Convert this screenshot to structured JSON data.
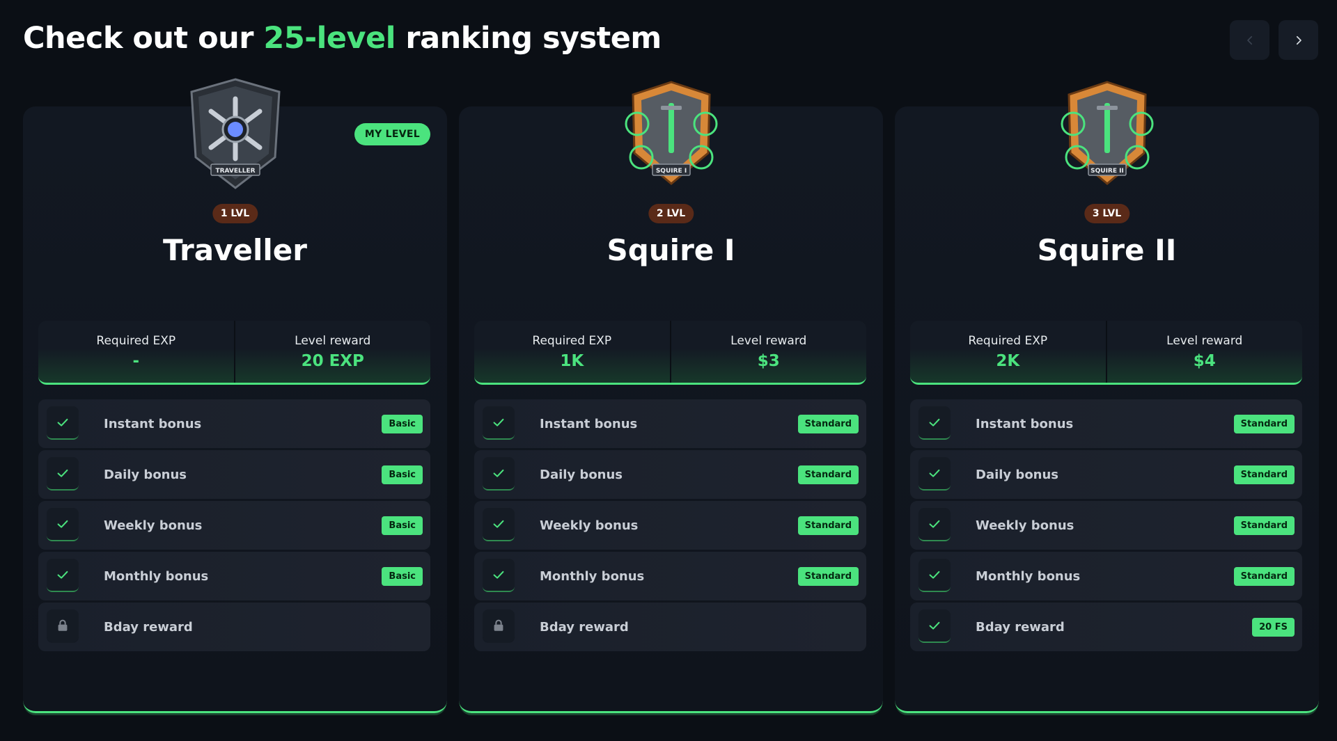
{
  "header": {
    "title_prefix": "Check out our ",
    "title_accent": "25-level",
    "title_suffix": " ranking system"
  },
  "nav": {
    "prev_icon": "chevron-left-icon",
    "next_icon": "chevron-right-icon"
  },
  "colors": {
    "accent": "#4be37e",
    "background": "#0b0f15",
    "card": "#121822",
    "level_pill": "#5a2a18"
  },
  "cards": [
    {
      "badge_text": "TRAVELLER",
      "badge_icon": "traveller-badge-icon",
      "my_level": "MY LEVEL",
      "level": "1 LVL",
      "name": "Traveller",
      "required_exp_label": "Required EXP",
      "required_exp": "-",
      "reward_label": "Level reward",
      "reward": "20 EXP",
      "features": [
        {
          "label": "Instant bonus",
          "tag": "Basic",
          "icon": "check-icon"
        },
        {
          "label": "Daily bonus",
          "tag": "Basic",
          "icon": "check-icon"
        },
        {
          "label": "Weekly bonus",
          "tag": "Basic",
          "icon": "check-icon"
        },
        {
          "label": "Monthly bonus",
          "tag": "Basic",
          "icon": "check-icon"
        },
        {
          "label": "Bday reward",
          "tag": "",
          "icon": "lock-icon"
        }
      ]
    },
    {
      "badge_text": "SQUIRE I",
      "badge_icon": "squire-badge-icon",
      "my_level": "",
      "level": "2 LVL",
      "name": "Squire I",
      "required_exp_label": "Required EXP",
      "required_exp": "1K",
      "reward_label": "Level reward",
      "reward": "$3",
      "features": [
        {
          "label": "Instant bonus",
          "tag": "Standard",
          "icon": "check-icon"
        },
        {
          "label": "Daily bonus",
          "tag": "Standard",
          "icon": "check-icon"
        },
        {
          "label": "Weekly bonus",
          "tag": "Standard",
          "icon": "check-icon"
        },
        {
          "label": "Monthly bonus",
          "tag": "Standard",
          "icon": "check-icon"
        },
        {
          "label": "Bday reward",
          "tag": "",
          "icon": "lock-icon"
        }
      ]
    },
    {
      "badge_text": "SQUIRE II",
      "badge_icon": "squire-badge-icon",
      "my_level": "",
      "level": "3 LVL",
      "name": "Squire II",
      "required_exp_label": "Required EXP",
      "required_exp": "2K",
      "reward_label": "Level reward",
      "reward": "$4",
      "features": [
        {
          "label": "Instant bonus",
          "tag": "Standard",
          "icon": "check-icon"
        },
        {
          "label": "Daily bonus",
          "tag": "Standard",
          "icon": "check-icon"
        },
        {
          "label": "Weekly bonus",
          "tag": "Standard",
          "icon": "check-icon"
        },
        {
          "label": "Monthly bonus",
          "tag": "Standard",
          "icon": "check-icon"
        },
        {
          "label": "Bday reward",
          "tag": "20 FS",
          "icon": "check-icon"
        }
      ]
    }
  ]
}
